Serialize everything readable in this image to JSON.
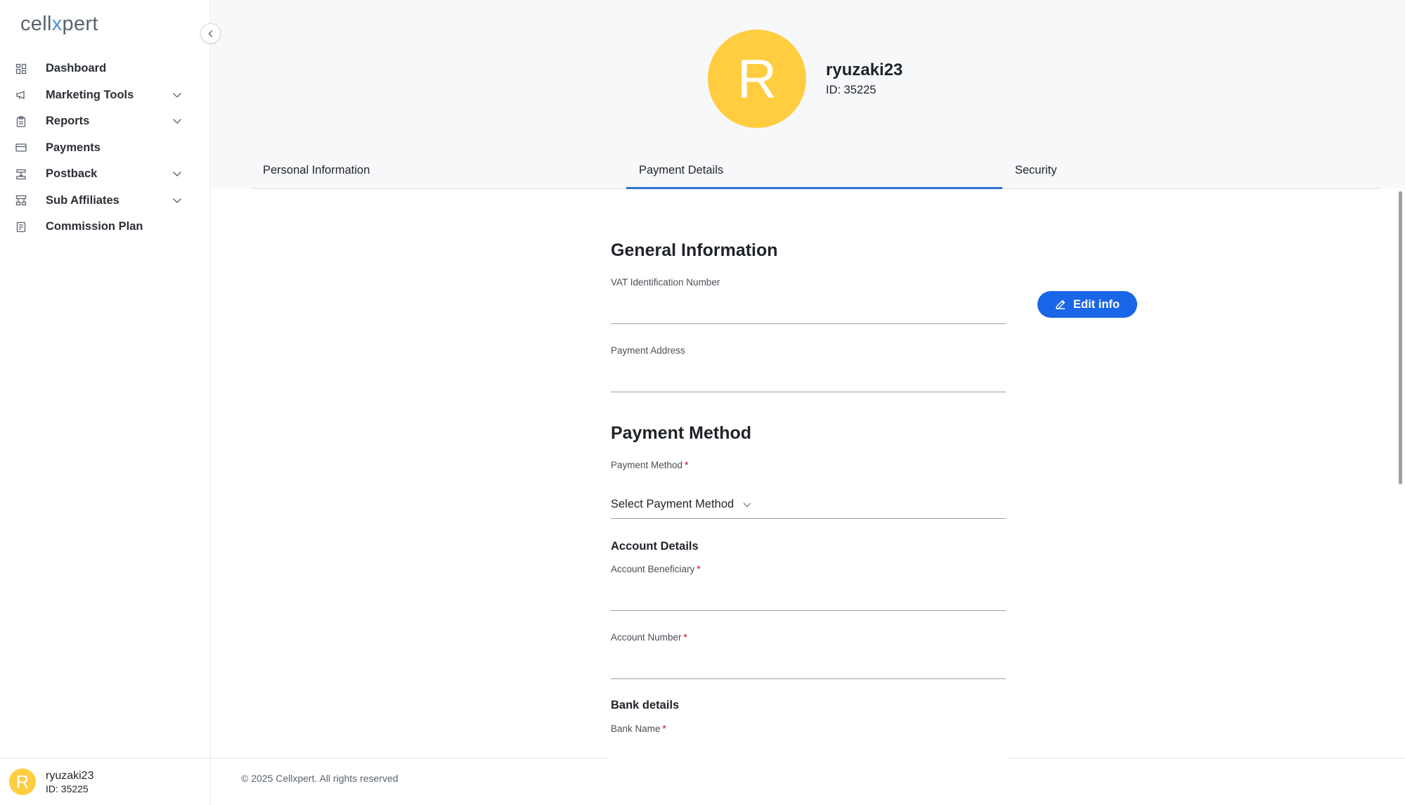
{
  "app": {
    "logo_prefix": "cell",
    "logo_x": "x",
    "logo_suffix": "pert"
  },
  "sidebar": {
    "items": [
      {
        "label": "Dashboard",
        "icon": "dashboard-icon",
        "expandable": false
      },
      {
        "label": "Marketing Tools",
        "icon": "megaphone-icon",
        "expandable": true
      },
      {
        "label": "Reports",
        "icon": "clipboard-icon",
        "expandable": true
      },
      {
        "label": "Payments",
        "icon": "credit-card-icon",
        "expandable": false
      },
      {
        "label": "Postback",
        "icon": "postback-icon",
        "expandable": true
      },
      {
        "label": "Sub Affiliates",
        "icon": "hierarchy-icon",
        "expandable": true
      },
      {
        "label": "Commission Plan",
        "icon": "document-icon",
        "expandable": false
      }
    ],
    "user": {
      "initial": "R",
      "name": "ryuzaki23",
      "id_text": "ID: 35225"
    }
  },
  "profile": {
    "initial": "R",
    "name": "ryuzaki23",
    "id_text": "ID: 35225"
  },
  "tabs": [
    {
      "label": "Personal Information",
      "active": false
    },
    {
      "label": "Payment Details",
      "active": true
    },
    {
      "label": "Security",
      "active": false
    }
  ],
  "form": {
    "general_title": "General Information",
    "vat_label": "VAT Identification Number",
    "vat_value": "",
    "address_label": "Payment Address",
    "address_value": "",
    "method_title": "Payment Method",
    "method_label": "Payment Method",
    "method_placeholder": "Select Payment Method",
    "account_title": "Account Details",
    "beneficiary_label": "Account Beneficiary",
    "account_number_label": "Account Number",
    "bank_title": "Bank details",
    "bank_name_label": "Bank Name",
    "required_mark": "*"
  },
  "actions": {
    "edit_label": "Edit info"
  },
  "footer": {
    "copyright": "© 2025 Cellxpert. All rights reserved"
  },
  "colors": {
    "accent": "#1a66e8",
    "avatar": "#ffcd3f",
    "tab_underline": "#2f6fd6",
    "required": "#d0021b"
  }
}
